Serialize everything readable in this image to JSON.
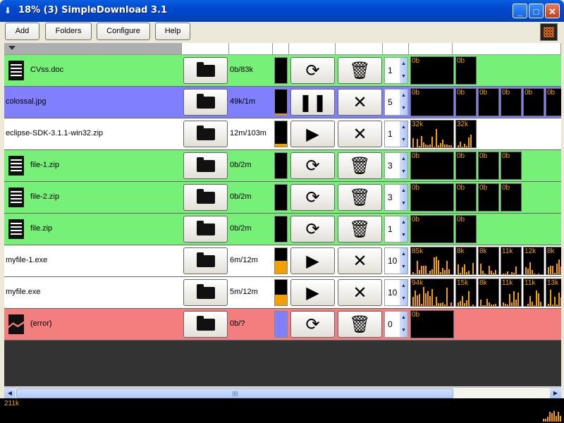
{
  "window": {
    "title": "18% (3) SimpleDownload 3.1"
  },
  "toolbar": {
    "add": "Add",
    "folders": "Folders",
    "configure": "Configure",
    "help": "Help"
  },
  "colors": {
    "green": "#77F077",
    "blue": "#8080FF",
    "red": "#F27E7E",
    "white": "#FFFFFF",
    "accent": "#F2A000"
  },
  "rows": [
    {
      "name": "CVss.doc",
      "icon": "document-icon",
      "color": "green",
      "size": "0b/83k",
      "progress": 0,
      "action": "refresh",
      "control": "trash",
      "count": "1",
      "graphs": [
        "0b",
        "0b"
      ]
    },
    {
      "name": "colossal.jpg",
      "icon": "",
      "color": "blue",
      "size": "49k/1m",
      "progress": 0.05,
      "action": "pause",
      "control": "cancel",
      "count": "5",
      "graphs": [
        "0b",
        "0b",
        "0b",
        "0b",
        "0b",
        "0b"
      ]
    },
    {
      "name": "eclipse-SDK-3.1.1-win32.zip",
      "icon": "",
      "color": "white",
      "size": "12m/103m",
      "progress": 0.12,
      "action": "play",
      "control": "cancel",
      "count": "1",
      "graphs": [
        "32k",
        "32k"
      ]
    },
    {
      "name": "file-1.zip",
      "icon": "document-icon",
      "color": "green",
      "size": "0b/2m",
      "progress": 0,
      "action": "refresh",
      "control": "trash",
      "count": "3",
      "graphs": [
        "0b",
        "0b",
        "0b",
        "0b"
      ]
    },
    {
      "name": "file-2.zip",
      "icon": "document-icon",
      "color": "green",
      "size": "0b/2m",
      "progress": 0,
      "action": "refresh",
      "control": "trash",
      "count": "3",
      "graphs": [
        "0b",
        "0b",
        "0b",
        "0b"
      ]
    },
    {
      "name": "file.zip",
      "icon": "document-icon",
      "color": "green",
      "size": "0b/2m",
      "progress": 0,
      "action": "refresh",
      "control": "trash",
      "count": "1",
      "graphs": [
        "0b",
        "0b"
      ]
    },
    {
      "name": "myfile-1.exe",
      "icon": "",
      "color": "white",
      "size": "6m/12m",
      "progress": 0.5,
      "action": "play",
      "control": "cancel",
      "count": "10",
      "graphs": [
        "85k",
        "8k",
        "8k",
        "11k",
        "12k",
        "8k"
      ]
    },
    {
      "name": "myfile.exe",
      "icon": "",
      "color": "white",
      "size": "5m/12m",
      "progress": 0.42,
      "action": "play",
      "control": "cancel",
      "count": "10",
      "graphs": [
        "94k",
        "15k",
        "8k",
        "11k",
        "11k",
        "13k"
      ]
    },
    {
      "name": "(error)",
      "icon": "broken-file-icon",
      "color": "red",
      "size": "0b/?",
      "progress": 0,
      "action": "refresh",
      "control": "trash",
      "count": "0",
      "graphs": [
        "0b"
      ]
    }
  ],
  "status": {
    "speed": "211k"
  }
}
